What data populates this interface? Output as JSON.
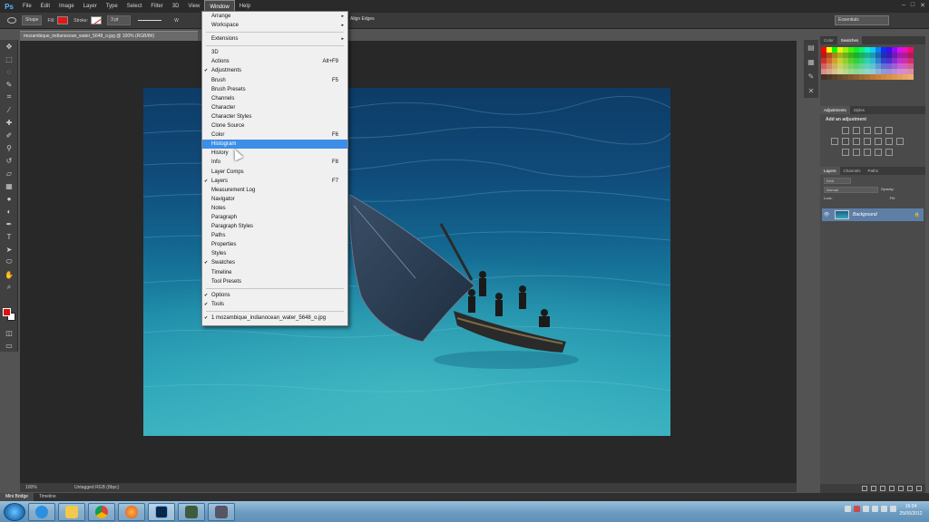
{
  "app": {
    "logo": "Ps"
  },
  "menubar": {
    "items": [
      "File",
      "Edit",
      "Image",
      "Layer",
      "Type",
      "Select",
      "Filter",
      "3D",
      "View",
      "Window",
      "Help"
    ],
    "window_controls": [
      "–",
      "□",
      "✕"
    ]
  },
  "options": {
    "mode": "Shape",
    "fill_label": "Fill:",
    "stroke_label": "Stroke:",
    "stroke_width": "3 pt",
    "w_label": "W",
    "align_edges": "Align Edges",
    "workspace": "Essentials",
    "colors": {
      "fill": "#e01818"
    }
  },
  "document": {
    "tab_title": "mozambique_indianocean_water_5648_o.jpg @ 100% (RGB/8#)",
    "zoom": "100%",
    "doc_info": "Untagged RGB (8bpc)"
  },
  "window_menu": {
    "items": [
      {
        "label": "Arrange",
        "submenu": true
      },
      {
        "label": "Workspace",
        "submenu": true
      },
      {
        "sep": true
      },
      {
        "label": "Extensions",
        "submenu": true
      },
      {
        "sep": true
      },
      {
        "label": "3D"
      },
      {
        "label": "Actions",
        "shortcut": "Alt+F9"
      },
      {
        "label": "Adjustments",
        "checked": true
      },
      {
        "label": "Brush",
        "shortcut": "F5"
      },
      {
        "label": "Brush Presets"
      },
      {
        "label": "Channels"
      },
      {
        "label": "Character"
      },
      {
        "label": "Character Styles"
      },
      {
        "label": "Clone Source"
      },
      {
        "label": "Color",
        "shortcut": "F6"
      },
      {
        "label": "Histogram",
        "highlighted": true
      },
      {
        "label": "History"
      },
      {
        "label": "Info",
        "shortcut": "F8"
      },
      {
        "label": "Layer Comps"
      },
      {
        "label": "Layers",
        "checked": true,
        "shortcut": "F7"
      },
      {
        "label": "Measurement Log"
      },
      {
        "label": "Navigator"
      },
      {
        "label": "Notes"
      },
      {
        "label": "Paragraph"
      },
      {
        "label": "Paragraph Styles"
      },
      {
        "label": "Paths"
      },
      {
        "label": "Properties"
      },
      {
        "label": "Styles"
      },
      {
        "label": "Swatches",
        "checked": true
      },
      {
        "label": "Timeline"
      },
      {
        "label": "Tool Presets"
      },
      {
        "sep": true
      },
      {
        "label": "Options",
        "checked": true
      },
      {
        "label": "Tools",
        "checked": true
      },
      {
        "sep": true
      },
      {
        "label": "1 mozambique_indianocean_water_5648_o.jpg",
        "checked": true
      }
    ]
  },
  "panels": {
    "swatch_tabs": [
      "Color",
      "Swatches"
    ],
    "adjust_tabs": [
      "Adjustments",
      "Styles"
    ],
    "adjust_title": "Add an adjustment",
    "layer_tabs": [
      "Layers",
      "Channels",
      "Paths"
    ],
    "layer_kind": "Kind",
    "blend_mode": "Normal",
    "opacity_label": "Opacity:",
    "lock_label": "Lock:",
    "fill_label": "Fill:",
    "layer_name": "Background"
  },
  "bottom_tabs": [
    "Mini Bridge",
    "Timeline"
  ],
  "taskbar": {
    "time": "16:34",
    "date": "25/06/2012"
  }
}
